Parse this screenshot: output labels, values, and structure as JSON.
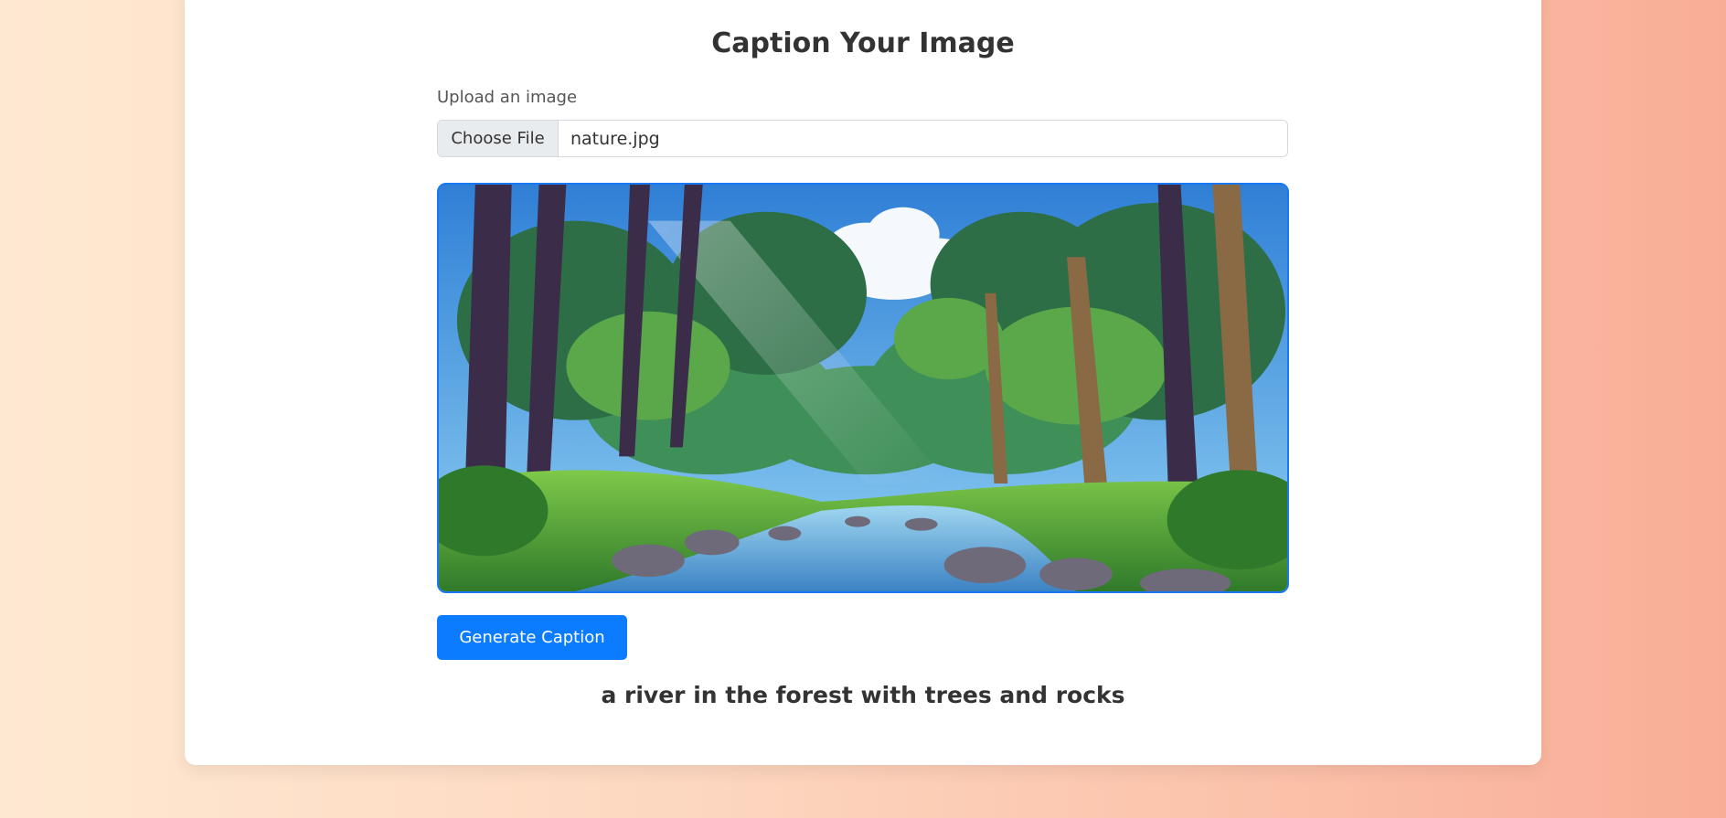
{
  "page": {
    "title": "Caption Your Image"
  },
  "upload": {
    "label": "Upload an image",
    "choose_button_label": "Choose File",
    "file_name": "nature.jpg"
  },
  "preview": {
    "alt": "Uploaded image preview: forest river scene"
  },
  "actions": {
    "generate_label": "Generate Caption"
  },
  "result": {
    "caption": "a river in the forest with trees and rocks"
  },
  "colors": {
    "accent": "#0b7cff",
    "preview_border": "#1877f2",
    "background_start": "#ffe9d2",
    "background_end": "#f9ad97"
  }
}
